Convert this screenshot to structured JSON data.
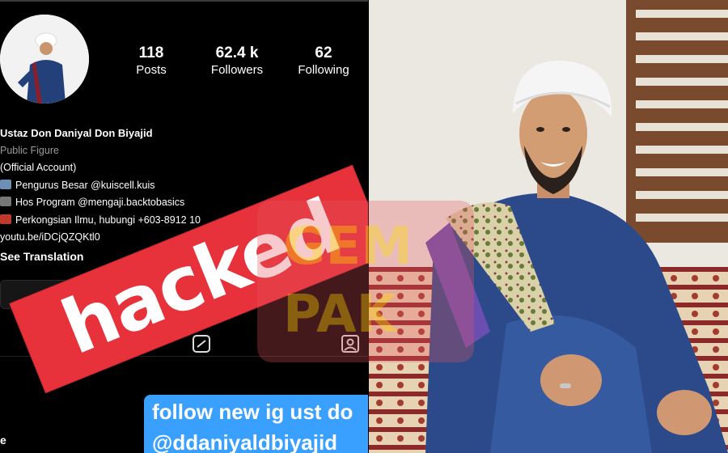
{
  "profile": {
    "stats": {
      "posts": {
        "value": "118",
        "label": "Posts"
      },
      "followers": {
        "value": "62.4 k",
        "label": "Followers"
      },
      "following": {
        "value": "62",
        "label": "Following"
      }
    },
    "bio": {
      "name": "Ustaz Don Daniyal Don Biyajid",
      "category": "Public Figure",
      "official": "(Official Account)",
      "line1": "Pengurus Besar @kuiscell.kuis",
      "line2": "Hos Program @mengaji.backtobasics",
      "line3": "Perkongsian Ilmu, hubungi +603-8912 10",
      "link": "youtu.be/iDCjQZQKtl0",
      "see_translation": "See Translation"
    }
  },
  "overlay": {
    "hacked": "hacked",
    "follow_line1": "follow new ig ust do",
    "follow_line2": "@ddaniyaldbiyajid",
    "corner": "e"
  },
  "watermark": {
    "text_top": "GEM",
    "text_bottom": "PAK"
  },
  "colors": {
    "banner_red": "#e7323b",
    "follow_blue": "#3aa0ff",
    "watermark_orange": "#f7b01c",
    "robe_blue": "#2c4a8a",
    "turban_white": "#f5f5f5"
  }
}
